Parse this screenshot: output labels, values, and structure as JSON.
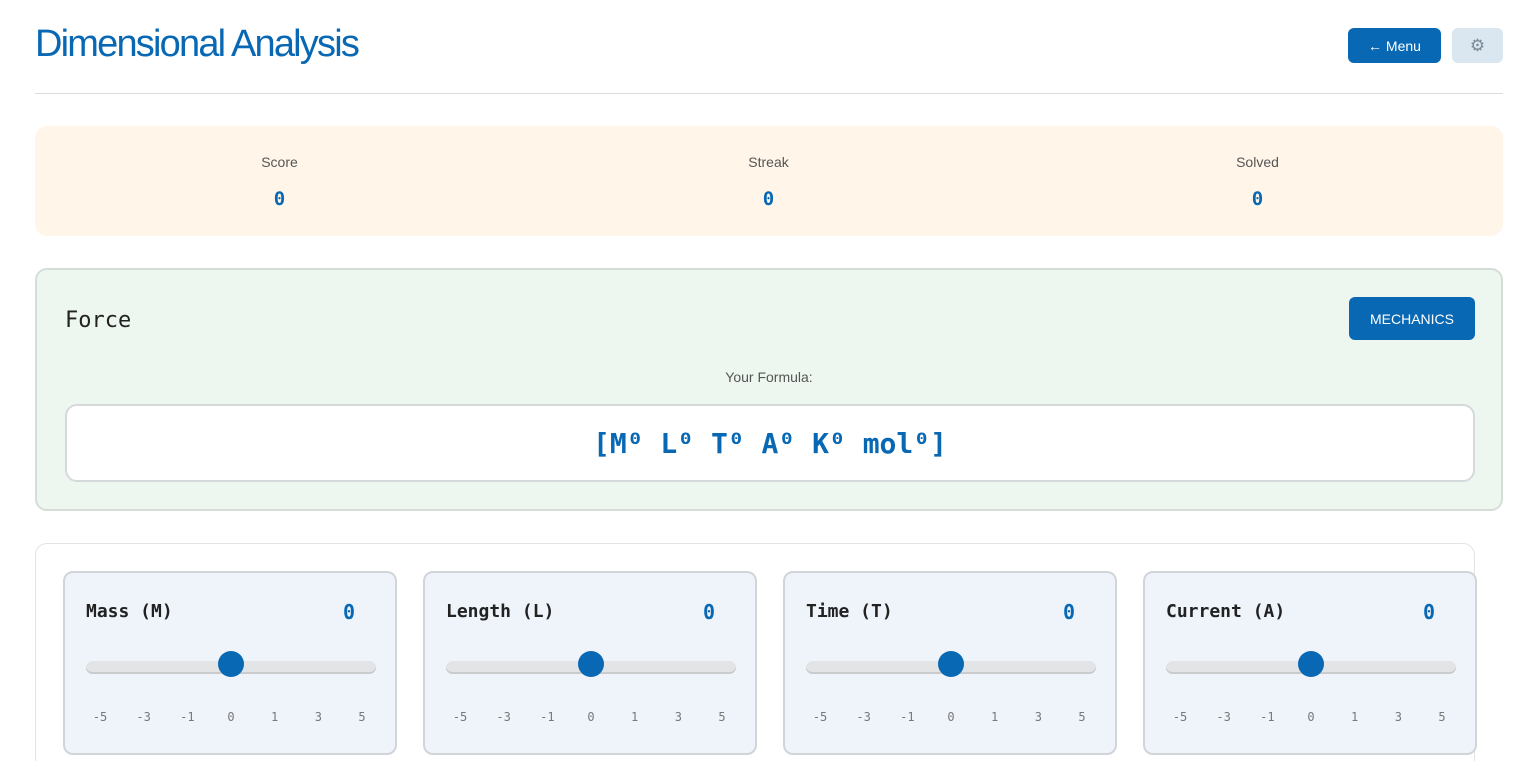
{
  "header": {
    "title": "Dimensional Analysis",
    "menu_label": "← Menu",
    "settings_icon": "gear-icon"
  },
  "stats": [
    {
      "label": "Score",
      "value": "0"
    },
    {
      "label": "Streak",
      "value": "0"
    },
    {
      "label": "Solved",
      "value": "0"
    }
  ],
  "problem": {
    "name": "Force",
    "category": "MECHANICS",
    "formula_label": "Your Formula:",
    "formula": "[M⁰ L⁰ T⁰ A⁰ K⁰ mol⁰]"
  },
  "dimensions": [
    {
      "name": "Mass (M)",
      "value": "0",
      "exponent": 0,
      "min": -5,
      "max": 5
    },
    {
      "name": "Length (L)",
      "value": "0",
      "exponent": 0,
      "min": -5,
      "max": 5
    },
    {
      "name": "Time (T)",
      "value": "0",
      "exponent": 0,
      "min": -5,
      "max": 5
    },
    {
      "name": "Current (A)",
      "value": "0",
      "exponent": 0,
      "min": -5,
      "max": 5
    }
  ],
  "ticks": [
    "-5",
    "-3",
    "-1",
    "0",
    "1",
    "3",
    "5"
  ],
  "colors": {
    "accent": "#0868b4",
    "stats_bg": "#fff6e9",
    "problem_bg": "#eef7ef",
    "card_bg": "#eff4fb"
  }
}
